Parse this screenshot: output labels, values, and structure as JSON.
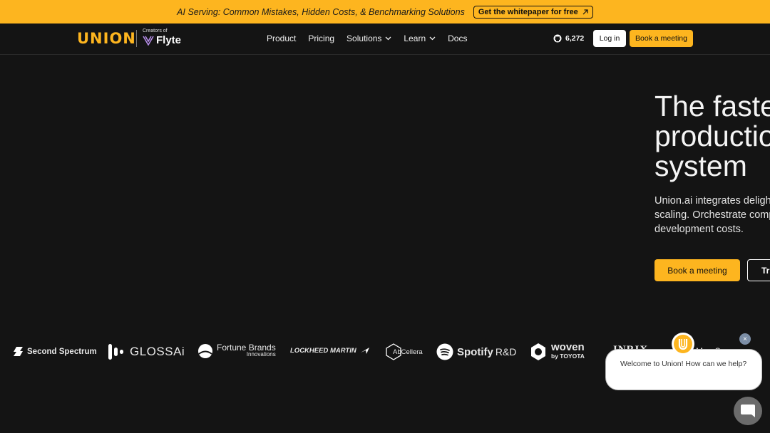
{
  "banner": {
    "text": "AI Serving: Common Mistakes, Hidden Costs, & Benchmarking Solutions",
    "cta": "Get the whitepaper for free"
  },
  "nav": {
    "logo": "UNION",
    "creators_of": "Creators of",
    "flyte": "Flyte",
    "links": [
      {
        "label": "Product"
      },
      {
        "label": "Pricing"
      },
      {
        "label": "Solutions"
      },
      {
        "label": "Learn"
      },
      {
        "label": "Docs"
      }
    ],
    "github_stars": "6,272",
    "login": "Log in",
    "book_meeting": "Book a meeting"
  },
  "hero": {
    "title_lines": [
      "The fastes",
      "productio",
      "system"
    ],
    "desc_lines": [
      "Union.ai integrates deligh",
      "scaling. Orchestrate comp",
      "development costs."
    ],
    "primary_cta": "Book a meeting",
    "secondary_cta": "Tr"
  },
  "customers": [
    {
      "name": "Second Spectrum"
    },
    {
      "name": "GLOSSAi"
    },
    {
      "name": "Fortune Brands",
      "sub": "Innovations"
    },
    {
      "name": "LOCKHEED MARTIN"
    },
    {
      "name": "AbCellera"
    },
    {
      "name": "Spotify",
      "suffix": "R&D"
    },
    {
      "name": "woven",
      "sub": "by TOYOTA"
    },
    {
      "name": "INRIX"
    },
    {
      "name": "MemSense"
    }
  ],
  "chat": {
    "greeting": "Welcome to Union! How can we help?",
    "close_symbol": "×"
  },
  "colors": {
    "brand_yellow": "#fdb51f",
    "background": "#141414"
  }
}
